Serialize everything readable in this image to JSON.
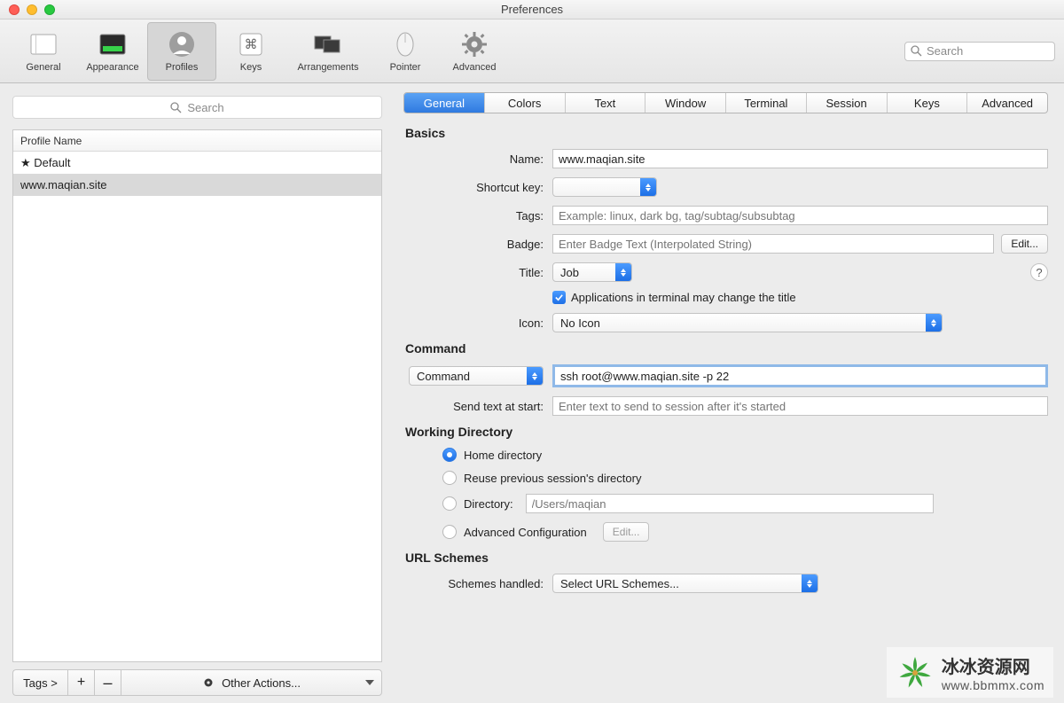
{
  "window": {
    "title": "Preferences"
  },
  "toolbar": {
    "items": [
      {
        "label": "General"
      },
      {
        "label": "Appearance"
      },
      {
        "label": "Profiles"
      },
      {
        "label": "Keys"
      },
      {
        "label": "Arrangements"
      },
      {
        "label": "Pointer"
      },
      {
        "label": "Advanced"
      }
    ],
    "search_placeholder": "Search"
  },
  "left": {
    "search_placeholder": "Search",
    "column_header": "Profile Name",
    "rows": [
      {
        "label": "★ Default"
      },
      {
        "label": "www.maqian.site"
      }
    ],
    "footer": {
      "tags": "Tags >",
      "plus": "+",
      "minus": "–",
      "other": "Other Actions..."
    }
  },
  "tabs": [
    "General",
    "Colors",
    "Text",
    "Window",
    "Terminal",
    "Session",
    "Keys",
    "Advanced"
  ],
  "basics": {
    "heading": "Basics",
    "name_label": "Name:",
    "name_value": "www.maqian.site",
    "shortcut_label": "Shortcut key:",
    "tags_label": "Tags:",
    "tags_placeholder": "Example: linux, dark bg, tag/subtag/subsubtag",
    "badge_label": "Badge:",
    "badge_placeholder": "Enter Badge Text (Interpolated String)",
    "edit_btn": "Edit...",
    "title_label": "Title:",
    "title_value": "Job",
    "title_checkbox": "Applications in terminal may change the title",
    "icon_label": "Icon:",
    "icon_value": "No Icon"
  },
  "command": {
    "heading": "Command",
    "mode": "Command",
    "value": "ssh root@www.maqian.site -p 22",
    "send_label": "Send text at start:",
    "send_placeholder": "Enter text to send to session after it's started"
  },
  "workdir": {
    "heading": "Working Directory",
    "opt_home": "Home directory",
    "opt_reuse": "Reuse previous session's directory",
    "opt_dir": "Directory:",
    "dir_placeholder": "/Users/maqian",
    "opt_adv": "Advanced Configuration",
    "edit_btn": "Edit..."
  },
  "url": {
    "heading": "URL Schemes",
    "label": "Schemes handled:",
    "value": "Select URL Schemes..."
  },
  "watermark": {
    "cn": "冰冰资源网",
    "url": "www.bbmmx.com"
  }
}
